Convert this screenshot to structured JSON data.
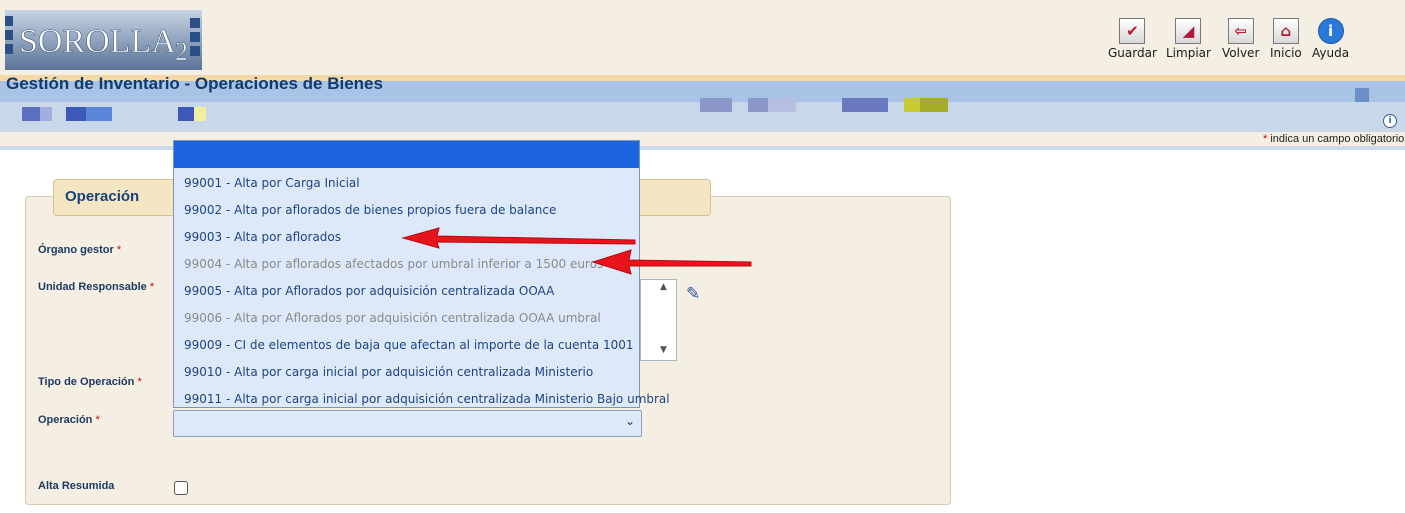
{
  "app": {
    "logo_text": "SOROLLA",
    "logo_suffix": "2"
  },
  "toolbar": [
    {
      "label": "Guardar",
      "icon": "save-icon"
    },
    {
      "label": "Limpiar",
      "icon": "eraser-icon"
    },
    {
      "label": "Volver",
      "icon": "back-arrow-icon"
    },
    {
      "label": "Inicio",
      "icon": "home-icon"
    },
    {
      "label": "Ayuda",
      "icon": "info-icon"
    }
  ],
  "page": {
    "title": "Gestión de Inventario - Operaciones de Bienes"
  },
  "required_note": {
    "asterisk": "*",
    "text": "indica un campo obligatorio"
  },
  "section": {
    "tab_label": "Operación"
  },
  "form": {
    "fields": [
      {
        "label": "Órgano gestor",
        "required": "*"
      },
      {
        "label": "Unidad Responsable",
        "required": "*"
      },
      {
        "label": "Tipo de Operación",
        "required": "*"
      },
      {
        "label": "Operación",
        "required": "*"
      },
      {
        "label": "Alta Resumida",
        "required": ""
      }
    ],
    "operacion_value": "",
    "alta_resumida_checked": false
  },
  "dropdown": {
    "selected": "",
    "options": [
      {
        "text": "99001 - Alta por Carga Inicial",
        "enabled": true
      },
      {
        "text": "99002 - Alta por aflorados de bienes propios fuera de balance",
        "enabled": true
      },
      {
        "text": "99003 - Alta por aflorados",
        "enabled": true
      },
      {
        "text": "99004 - Alta por aflorados afectados por umbral inferior a 1500 euros",
        "enabled": false
      },
      {
        "text": "99005 - Alta por Aflorados por adquisición centralizada OOAA",
        "enabled": true
      },
      {
        "text": "99006 - Alta por Aflorados por adquisición centralizada OOAA umbral",
        "enabled": false
      },
      {
        "text": "99009 - CI de elementos de baja que afectan al importe de la cuenta 1001",
        "enabled": true
      },
      {
        "text": "99010 - Alta por carga inicial por adquisición centralizada Ministerio",
        "enabled": true
      },
      {
        "text": "99011 - Alta por carga inicial por adquisición centralizada Ministerio Bajo umbral",
        "enabled": true
      }
    ]
  },
  "colors": {
    "accent_blue": "#1c64e0",
    "header_bg": "#f5efe3",
    "title_bar": "#a9c3e6",
    "arrow_red": "#e8141b"
  }
}
